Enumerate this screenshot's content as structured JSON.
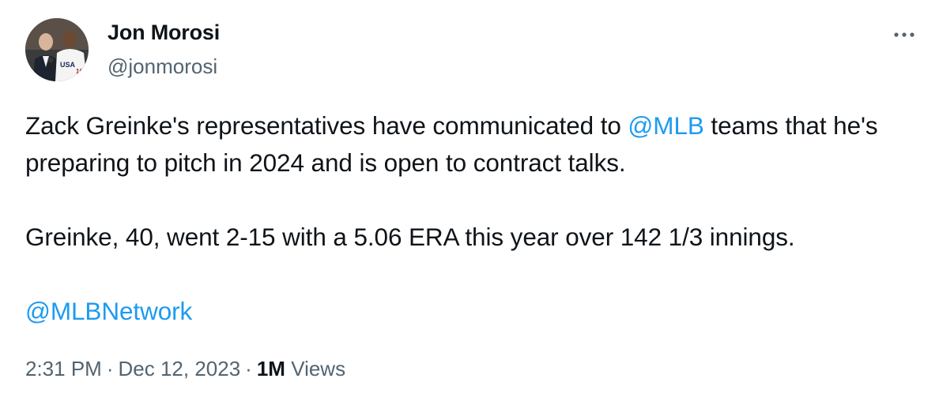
{
  "author": {
    "display_name": "Jon Morosi",
    "handle": "@jonmorosi"
  },
  "more_icon": "more-horizontal-icon",
  "tweet": {
    "line1_before": "Zack Greinke's representatives have communicated to ",
    "mention_mlb": "@MLB",
    "line1_after": " teams that he's preparing to pitch in 2024 and is open to contract talks.",
    "paragraph2": "Greinke, 40, went 2-15 with a 5.06 ERA this year over 142 1/3 innings.",
    "mention_network": "@MLBNetwork"
  },
  "meta": {
    "time": "2:31 PM",
    "separator": "·",
    "date": "Dec 12, 2023",
    "views_count": "1M",
    "views_label": "Views"
  },
  "colors": {
    "text": "#0f1419",
    "secondary": "#536471",
    "link": "#1d9bf0"
  }
}
